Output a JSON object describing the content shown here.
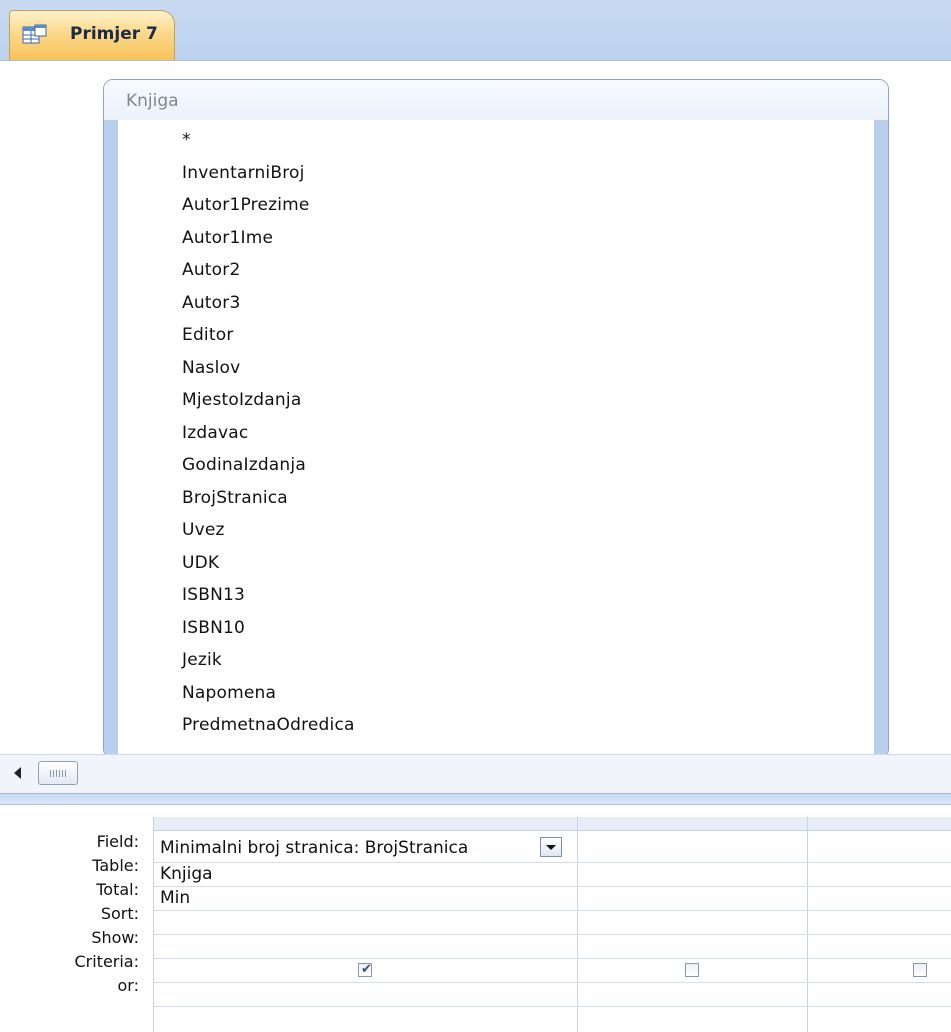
{
  "tab": {
    "title": "Primjer 7",
    "icon": "query-icon"
  },
  "table": {
    "title": "Knjiga",
    "fields": [
      "*",
      "InventarniBroj",
      "Autor1Prezime",
      "Autor1Ime",
      "Autor2",
      "Autor3",
      "Editor",
      "Naslov",
      "MjestoIzdanja",
      "Izdavac",
      "GodinaIzdanja",
      "BrojStranica",
      "Uvez",
      "UDK",
      "ISBN13",
      "ISBN10",
      "Jezik",
      "Napomena",
      "PredmetnaOdredica"
    ]
  },
  "grid": {
    "row_labels": {
      "field": "Field:",
      "table": "Table:",
      "total": "Total:",
      "sort": "Sort:",
      "show": "Show:",
      "criteria": "Criteria:",
      "or": "or:"
    },
    "columns": [
      {
        "field": "Minimalni broj stranica: BrojStranica",
        "table": "Knjiga",
        "total": "Min",
        "sort": "",
        "show": true,
        "criteria": "",
        "or": ""
      },
      {
        "field": "",
        "table": "",
        "total": "",
        "sort": "",
        "show": false,
        "criteria": "",
        "or": ""
      },
      {
        "field": "",
        "table": "",
        "total": "",
        "sort": "",
        "show": false,
        "criteria": "",
        "or": ""
      }
    ]
  },
  "colors": {
    "tab_accent": "#f7c35a",
    "frame_blue": "#b9cfee"
  }
}
